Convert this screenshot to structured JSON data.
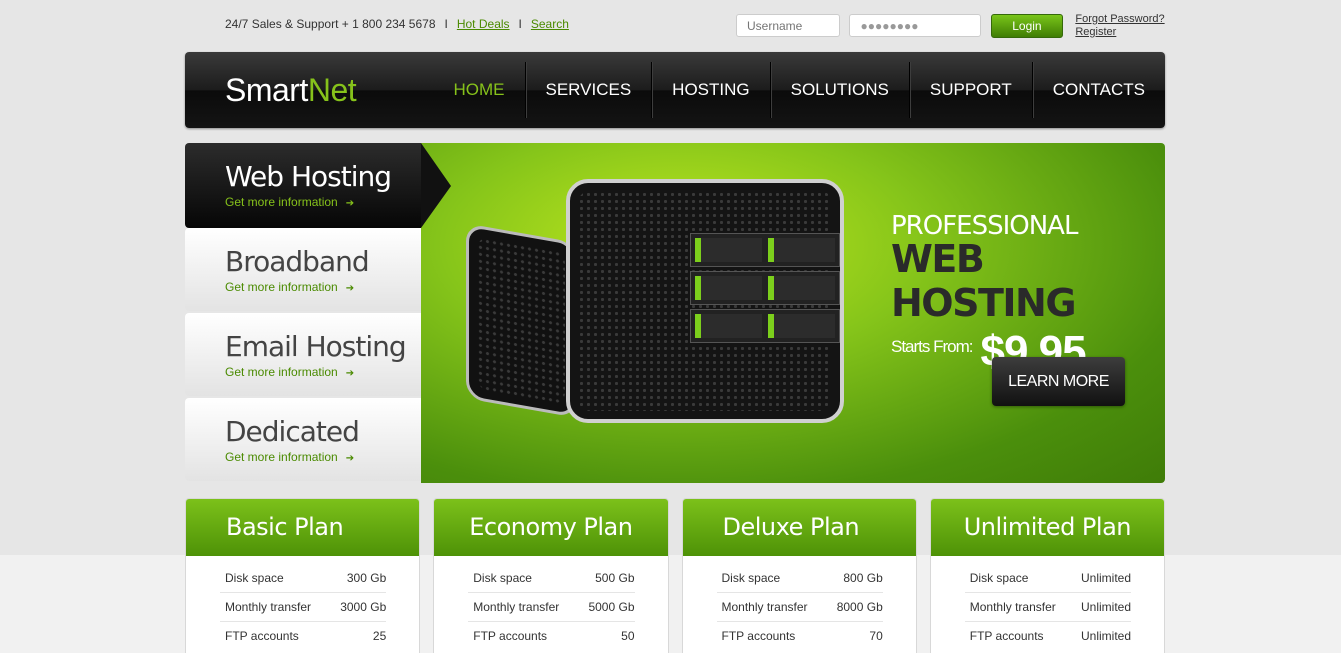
{
  "topbar": {
    "phone_text": "24/7 Sales & Support + 1 800 234 5678",
    "separator": "I",
    "hot_deals": "Hot Deals",
    "search": "Search"
  },
  "login": {
    "username_placeholder": "Username",
    "password_value": "●●●●●●●●",
    "login_label": "Login",
    "forgot": "Forgot Password?",
    "register": "Register"
  },
  "logo": {
    "smart": "Smart",
    "net": "Net"
  },
  "nav": {
    "items": [
      "HOME",
      "SERVICES",
      "HOSTING",
      "SOLUTIONS",
      "SUPPORT",
      "CONTACTS"
    ],
    "active": "HOME"
  },
  "slider": {
    "tabs": [
      {
        "title": "Web Hosting",
        "more": "Get more information"
      },
      {
        "title": "Broadband",
        "more": "Get more information"
      },
      {
        "title": "Email Hosting",
        "more": "Get more information"
      },
      {
        "title": "Dedicated",
        "more": "Get more information"
      }
    ],
    "promo": {
      "line1": "PROFESSIONAL",
      "line2": "WEB HOSTING",
      "starts_from": "Starts From:",
      "price": "$9.95",
      "cta": "LEARN MORE"
    }
  },
  "plans": [
    {
      "name": "Basic Plan",
      "rows": [
        {
          "label": "Disk space",
          "value": "300 Gb"
        },
        {
          "label": "Monthly transfer",
          "value": "3000 Gb"
        },
        {
          "label": "FTP accounts",
          "value": "25"
        }
      ]
    },
    {
      "name": "Economy Plan",
      "rows": [
        {
          "label": "Disk space",
          "value": "500 Gb"
        },
        {
          "label": "Monthly transfer",
          "value": "5000 Gb"
        },
        {
          "label": "FTP accounts",
          "value": "50"
        }
      ]
    },
    {
      "name": "Deluxe Plan",
      "rows": [
        {
          "label": "Disk space",
          "value": "800 Gb"
        },
        {
          "label": "Monthly transfer",
          "value": "8000 Gb"
        },
        {
          "label": "FTP accounts",
          "value": "70"
        }
      ]
    },
    {
      "name": "Unlimited Plan",
      "rows": [
        {
          "label": "Disk space",
          "value": "Unlimited"
        },
        {
          "label": "Monthly transfer",
          "value": "Unlimited"
        },
        {
          "label": "FTP accounts",
          "value": "Unlimited"
        }
      ]
    }
  ],
  "colors": {
    "accent": "#86c21b",
    "link": "#4a8a00",
    "nav_bg": "#1c1c1c"
  },
  "icons": {
    "arrow": "arrow-right-icon"
  }
}
